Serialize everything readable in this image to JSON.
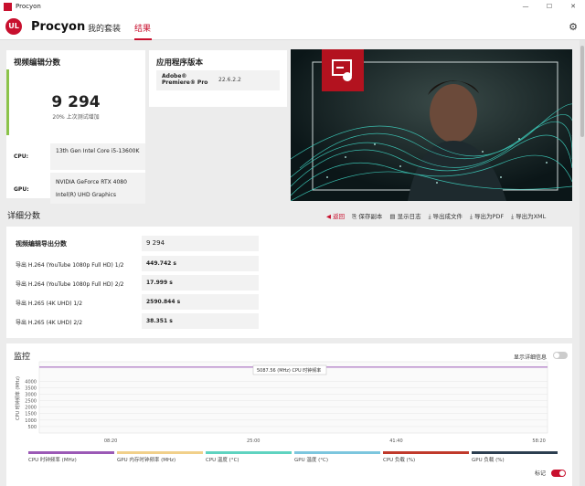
{
  "window": {
    "title": "Procyon",
    "minimize": "—",
    "maximize": "☐",
    "close": "✕"
  },
  "nav": {
    "logo": "UL",
    "brand": "Procyon",
    "tabs": [
      {
        "label": "我的套装"
      },
      {
        "label": "结果"
      }
    ],
    "active_tab": 1
  },
  "score": {
    "title": "视频编辑分数",
    "value": "9 294",
    "subtitle": "20% 上次测试增加",
    "cpu_label": "CPU:",
    "cpu_value": "13th Gen Intel Core i5-13600K",
    "gpu_label": "GPU:",
    "gpu_values": [
      "NVIDIA GeForce RTX 4080",
      "Intel(R) UHD Graphics"
    ]
  },
  "app_version": {
    "title": "应用程序版本",
    "app_name": "Adobe® Premiere® Pro",
    "version": "22.6.2.2"
  },
  "details": {
    "title": "详细分数",
    "actions": {
      "back": "返回",
      "save": "保存副本",
      "show_log": "显示日志",
      "export_file": "导出成文件",
      "export_pdf": "导出为PDF",
      "export_xml": "导出为XML"
    },
    "main_label": "视频编辑导出分数",
    "main_value": "9 294",
    "rows": [
      {
        "label": "导出 H.264 (YouTube 1080p Full HD) 1/2",
        "value": "449.742 s"
      },
      {
        "label": "导出 H.264 (YouTube 1080p Full HD) 2/2",
        "value": "17.999 s"
      },
      {
        "label": "导出 H.265 (4K UHD) 1/2",
        "value": "2590.844 s"
      },
      {
        "label": "导出 H.265 (4K UHD) 2/2",
        "value": "38.351 s"
      }
    ]
  },
  "monitoring": {
    "title": "监控",
    "detail_toggle_label": "显示详细信息",
    "marker_label": "标记",
    "tooltip": "5087.56 (MHz) CPU 时钟频率",
    "y_axis_label": "CPU 时钟频率 (MHz)",
    "legend": [
      {
        "label": "CPU 时钟频率 (MHz)",
        "color": "#9b59b6"
      },
      {
        "label": "GPU 内存时钟频率 (MHz)",
        "color": "#f1d08a"
      },
      {
        "label": "CPU 温度 (°C)",
        "color": "#5fd3c0"
      },
      {
        "label": "GPU 温度 (°C)",
        "color": "#7cc6de"
      },
      {
        "label": "CPU 负载 (%)",
        "color": "#c0392b"
      },
      {
        "label": "GPU 负载 (%)",
        "color": "#2c3e50"
      }
    ]
  },
  "chart_data": {
    "type": "line",
    "ylabel": "CPU 时钟频率 (MHz)",
    "ylim": [
      0,
      5500
    ],
    "yticks": [
      500,
      1000,
      1500,
      2000,
      2500,
      3000,
      3500,
      4000
    ],
    "xtick_labels": [
      "08:20",
      "25:00",
      "41:40",
      "58:20"
    ],
    "xtick_values": [
      500,
      1500,
      2500,
      3500
    ],
    "xlim": [
      0,
      3560
    ],
    "series": [
      {
        "name": "CPU 时钟频率 (MHz)",
        "x": [
          0,
          900,
          1600,
          2600,
          3560
        ],
        "values": [
          5087,
          5087,
          5087,
          5087,
          5087
        ]
      }
    ],
    "grid": true
  }
}
